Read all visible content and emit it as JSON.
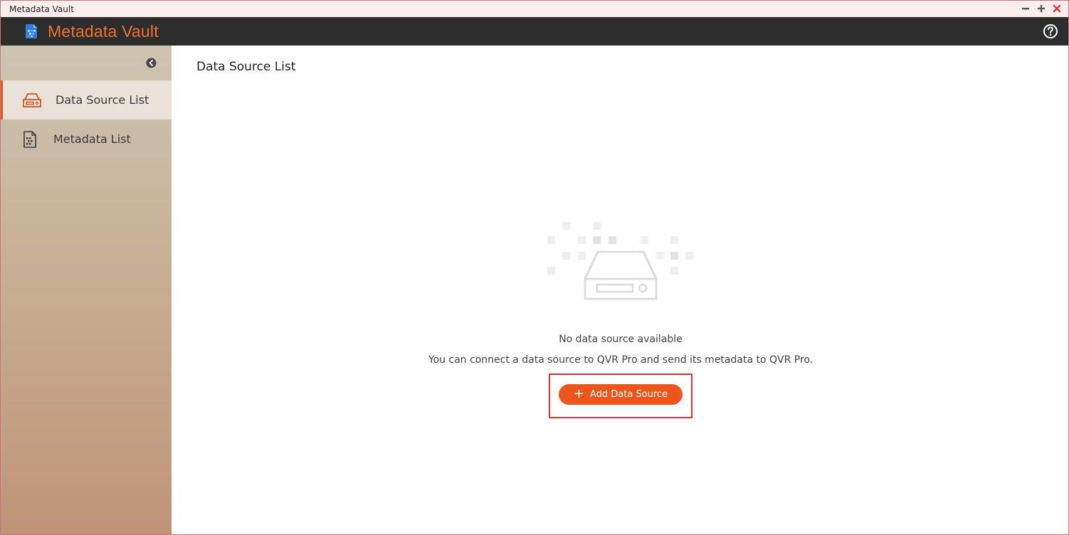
{
  "window": {
    "title": "Metadata Vault",
    "controls": [
      "minimize-icon",
      "maximize-icon",
      "close-icon"
    ]
  },
  "header": {
    "app_name": "Metadata Vault",
    "logo_icon": "metadata-vault-logo-icon",
    "help_icon": "help-icon",
    "accent_color": "#f0722f",
    "bar_color": "#2d2d2d"
  },
  "sidebar": {
    "collapse_icon": "chevron-left-icon",
    "items": [
      {
        "label": "Data Source List",
        "icon": "drive-icon",
        "active": true
      },
      {
        "label": "Metadata List",
        "icon": "document-grid-icon",
        "active": false
      }
    ]
  },
  "main": {
    "title": "Data Source List",
    "empty_state": {
      "icon": "drive-icon",
      "title": "No data source available",
      "description": "You can connect a data source to QVR Pro and send its metadata to QVR Pro."
    },
    "add_button": {
      "label": "Add Data Source",
      "icon": "plus-icon",
      "color": "#ec561e"
    },
    "highlight_color": "#e0333a"
  }
}
